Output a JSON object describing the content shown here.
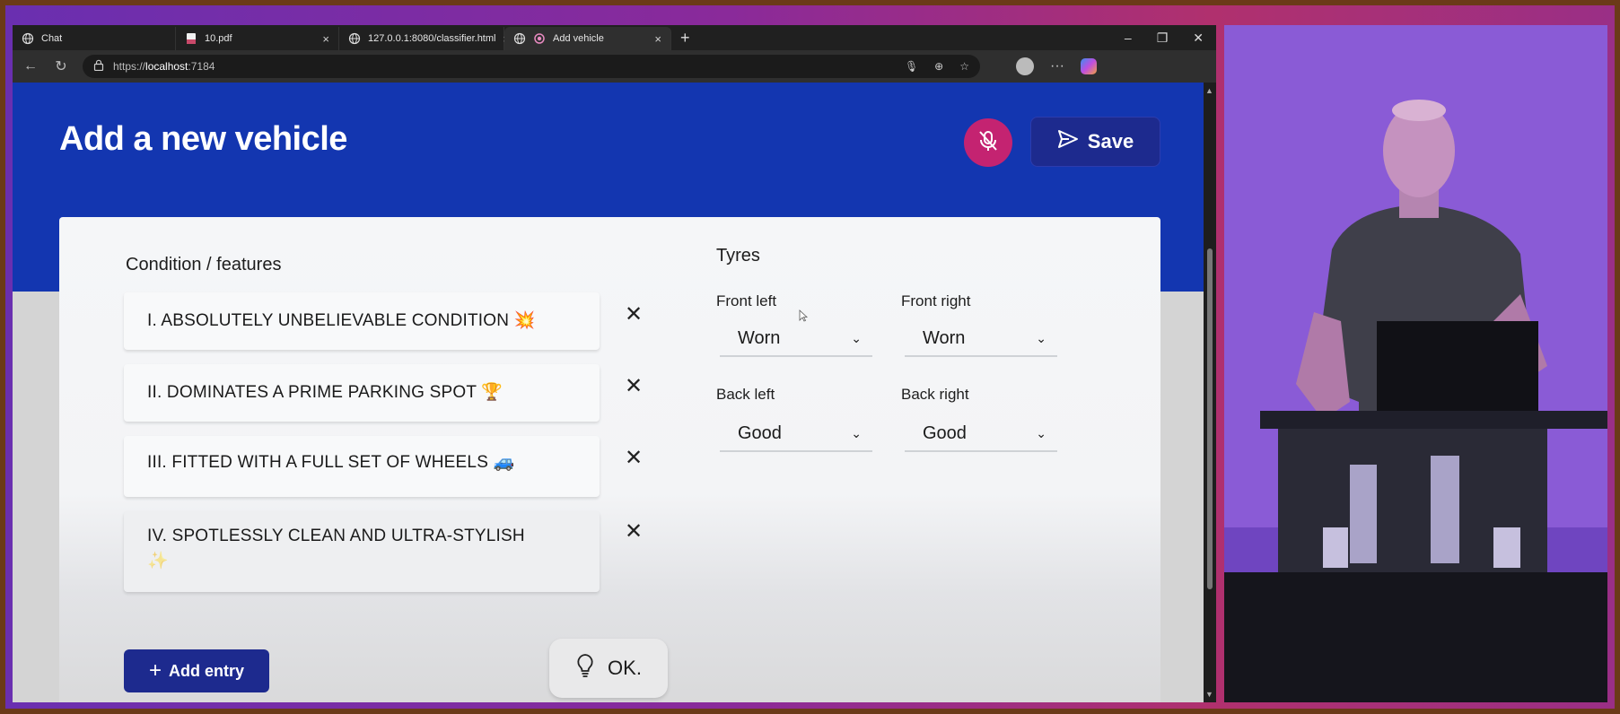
{
  "browser": {
    "tabs": [
      {
        "label": "Chat",
        "icon": "globe-icon",
        "active": false
      },
      {
        "label": "10.pdf",
        "icon": "pdf-icon",
        "active": false
      },
      {
        "label": "127.0.0.1:8080/classifier.html",
        "icon": "globe-icon",
        "active": false
      },
      {
        "label": "Add vehicle",
        "icon": "globe-icon",
        "active": true
      }
    ],
    "url_prefix": "https://",
    "url_host": "localhost",
    "url_rest": ":7184"
  },
  "page": {
    "title": "Add a new vehicle",
    "save_label": "Save",
    "condition_label": "Condition / features",
    "entries": [
      {
        "text": "I. ABSOLUTELY UNBELIEVABLE CONDITION",
        "emoji": "💥"
      },
      {
        "text": "II. DOMINATES A PRIME PARKING SPOT",
        "emoji": "🏆"
      },
      {
        "text": "III. FITTED WITH A FULL SET OF WHEELS",
        "emoji": "🚙"
      },
      {
        "text": "IV. SPOTLESSLY CLEAN AND ULTRA-STYLISH",
        "emoji": "✨"
      }
    ],
    "add_entry_label": "Add entry",
    "ok_label": "OK.",
    "tyres": {
      "label": "Tyres",
      "front_left_label": "Front left",
      "front_left_value": "Worn",
      "front_right_label": "Front right",
      "front_right_value": "Worn",
      "back_left_label": "Back left",
      "back_left_value": "Good",
      "back_right_label": "Back right",
      "back_right_value": "Good"
    }
  },
  "colors": {
    "hero": "#1336b0",
    "button": "#1d2a8e",
    "mic": "#c42371"
  }
}
